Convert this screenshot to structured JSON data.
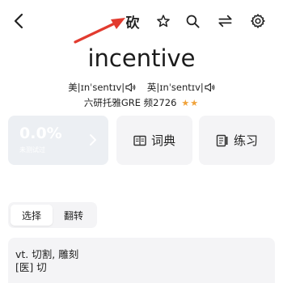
{
  "toolbar": {
    "cut_label": "砍",
    "icons": [
      "back-arrow-icon",
      "star-icon",
      "search-icon",
      "swap-icon",
      "gear-icon"
    ]
  },
  "word": {
    "text": "incentive",
    "us_phonetic": "美|ɪnˈsentɪv|",
    "uk_phonetic": "英|ɪnˈsentɪv|",
    "tags": "六研托雅GRE 频2726",
    "stars": "★★",
    "star_color": "#f0a23a"
  },
  "progress": {
    "percent": "0.0%",
    "sub_label": "未测试过",
    "value": 0
  },
  "cards": {
    "dictionary": "词典",
    "practice": "练习"
  },
  "modes": {
    "select": "选择",
    "flip": "翻转",
    "active": "select"
  },
  "definition": {
    "line1": "vt. 切割, 雕刻",
    "line2": "[医] 切"
  },
  "annotation": {
    "arrow_color": "#e23b2f"
  }
}
